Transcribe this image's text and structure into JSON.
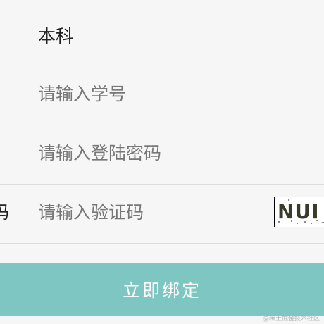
{
  "form": {
    "degree_value": "本科",
    "student_id_placeholder": "请输入学号",
    "password_placeholder": "请输入登陆密码",
    "captcha_label_fragment": "码",
    "captcha_placeholder": "请输入验证码",
    "captcha_image_text": "NUI"
  },
  "submit": {
    "label": "立即绑定"
  },
  "watermark": {
    "text": "@稀土掘金技术社区"
  },
  "colors": {
    "background": "#f6f6f6",
    "divider": "#dcdcdc",
    "button": "#7ec6c1",
    "placeholder": "#777777",
    "text": "#222222"
  }
}
